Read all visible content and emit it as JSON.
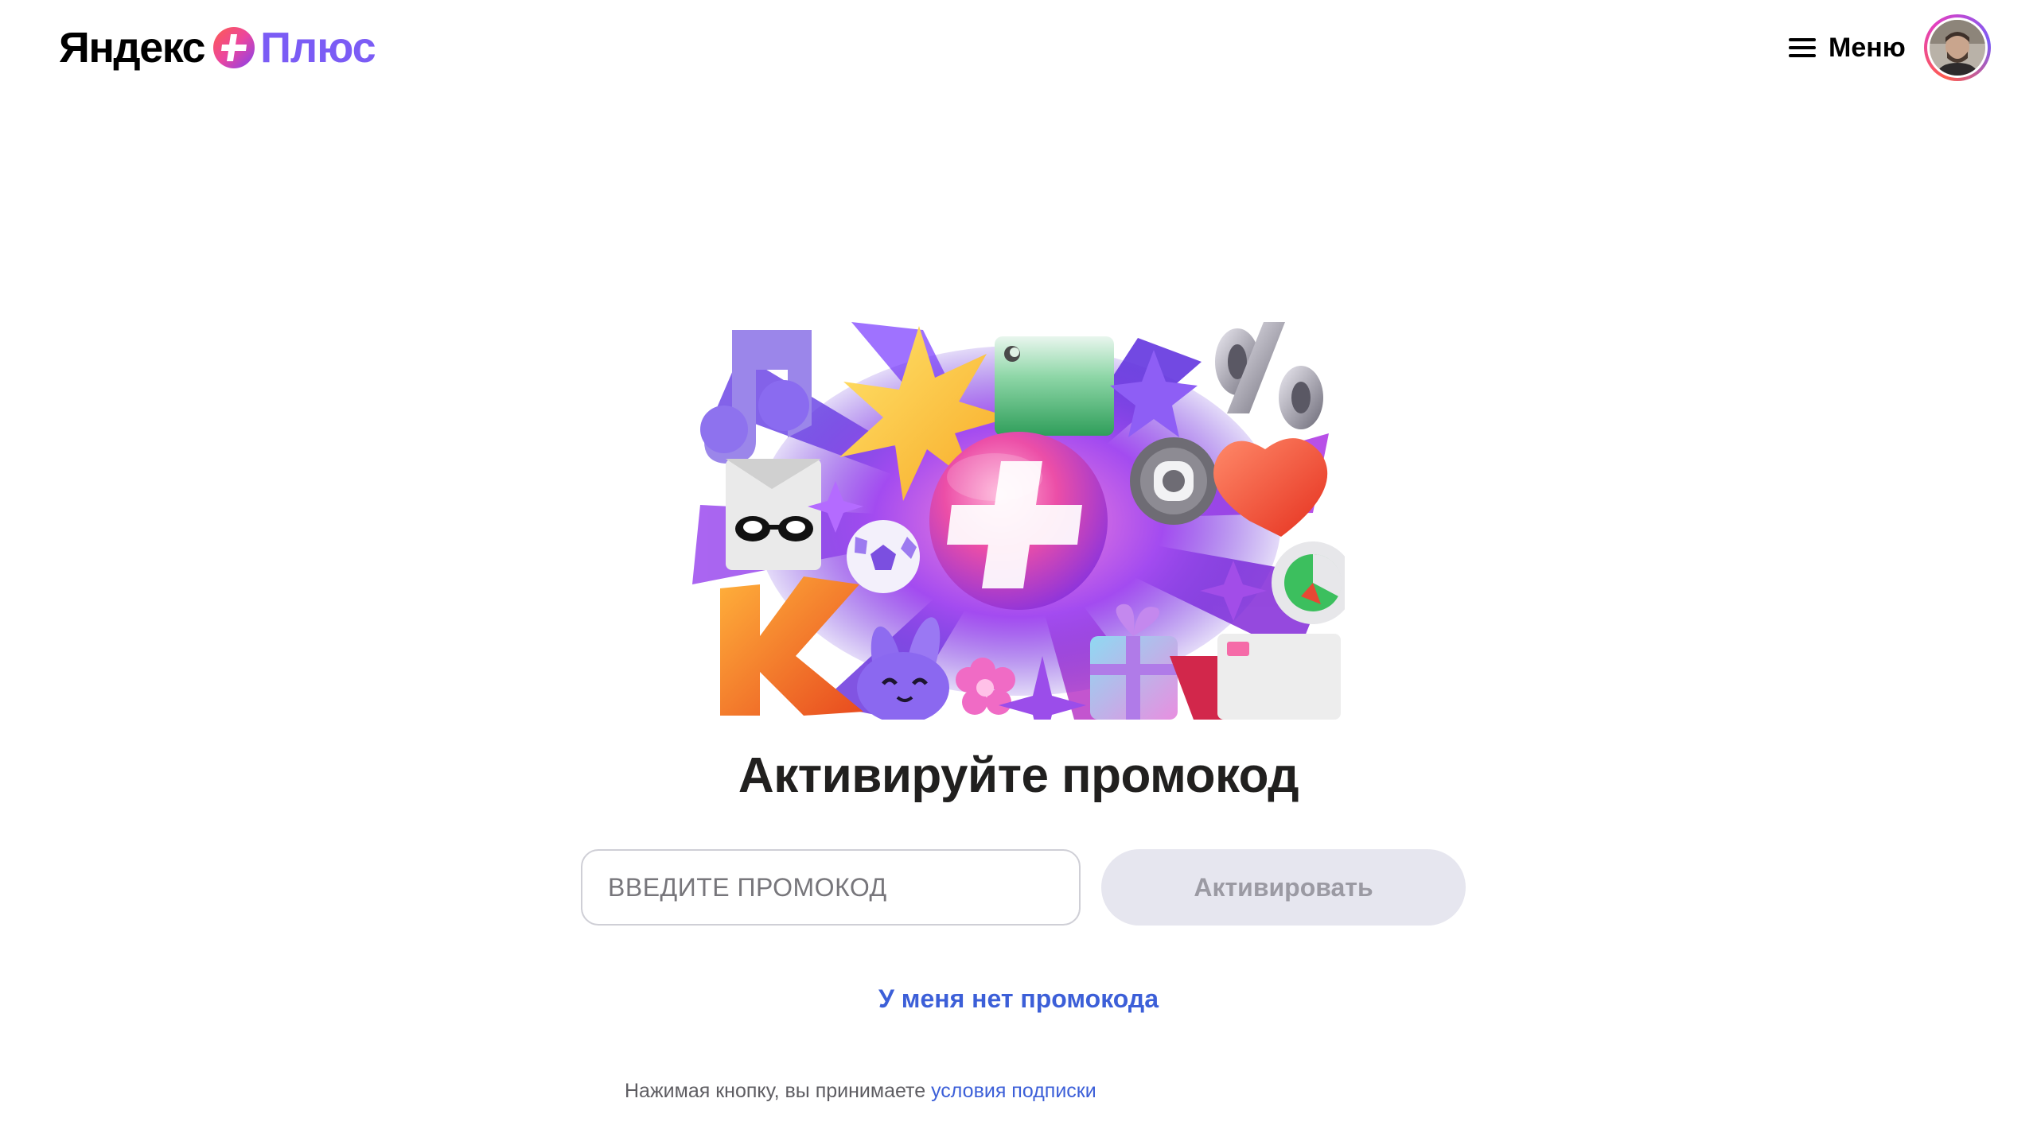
{
  "header": {
    "logo_yandex": "Яндекс",
    "logo_plus": "Плюс",
    "menu_label": "Меню"
  },
  "main": {
    "title": "Активируйте промокод",
    "promo_placeholder": "ВВЕДИТЕ ПРОМОКОД",
    "promo_value": "",
    "activate_label": "Активировать",
    "activate_enabled": false,
    "no_code_link": "У меня нет промокода"
  },
  "footer": {
    "terms_text": "Нажимая кнопку, вы принимаете",
    "terms_link": "условия подписки"
  },
  "colors": {
    "brand_purple": "#7b5cf5",
    "link_blue": "#3c5fd8",
    "button_disabled_bg": "#e6e6ef",
    "button_disabled_text": "#9b9aa3"
  },
  "icons": [
    "plus-logo-badge-icon",
    "hamburger-menu-icon",
    "user-avatar"
  ]
}
